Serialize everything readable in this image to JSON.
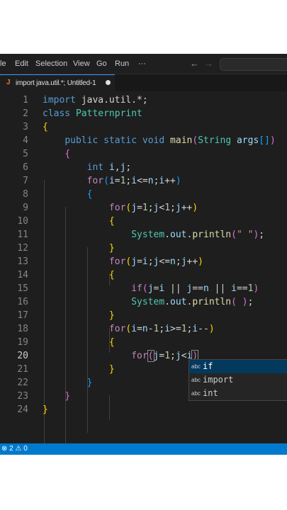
{
  "menubar": {
    "items": [
      "le",
      "Edit",
      "Selection",
      "View",
      "Go",
      "Run",
      "···"
    ],
    "back_icon": "arrow-left-icon",
    "forward_icon": "arrow-right-icon"
  },
  "tab": {
    "label": "import java.util.*; Untitled-1",
    "icon": "java-file-icon",
    "dirty": true
  },
  "editor": {
    "active_line": 20,
    "line_numbers": [
      "1",
      "2",
      "3",
      "4",
      "5",
      "6",
      "7",
      "8",
      "9",
      "10",
      "11",
      "12",
      "13",
      "14",
      "15",
      "16",
      "17",
      "18",
      "19",
      "20",
      "21",
      "22",
      "23",
      "24"
    ]
  },
  "suggest": {
    "icon_text": "abc",
    "items": [
      "if",
      "import",
      "int"
    ]
  },
  "statusbar": {
    "problems": "⊗ 2 ⚠ 0"
  },
  "colors": {
    "accent": "#007acc",
    "editor_bg": "#1e1e1e",
    "keyword": "#569cd6",
    "type": "#4ec9b0"
  }
}
